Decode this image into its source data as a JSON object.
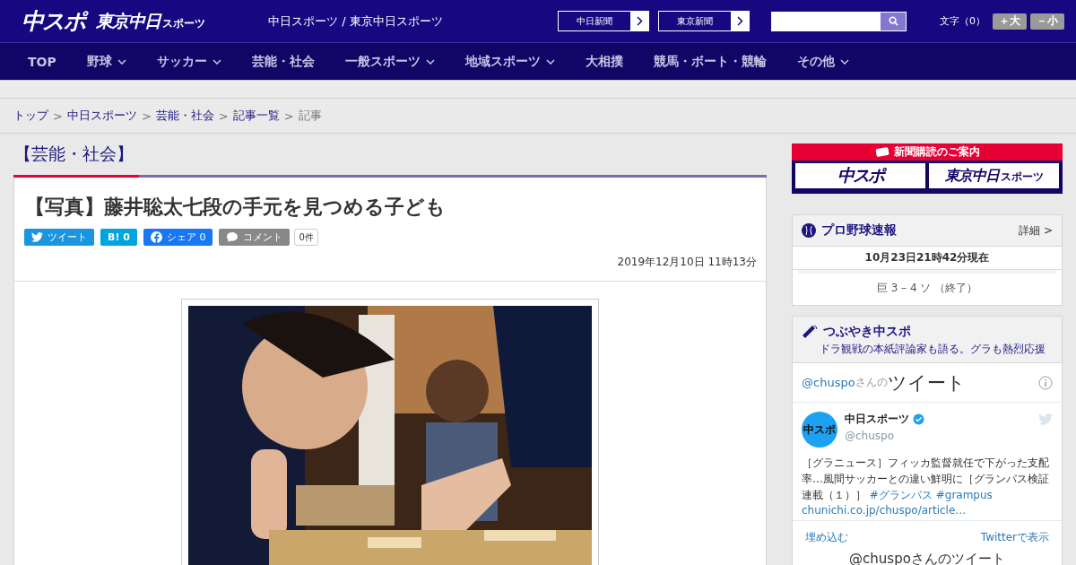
{
  "header": {
    "logo": {
      "main": "中スポ",
      "sub": "東京中日",
      "sub_small": "スポーツ"
    },
    "site_title": "中日スポーツ / 東京中日スポーツ",
    "paper_links": [
      "中日新聞",
      "東京新聞"
    ],
    "font_size": {
      "label": "文字（0）",
      "buttons": [
        "＋大",
        "－小"
      ]
    }
  },
  "nav": [
    {
      "label": "TOP",
      "has_menu": false
    },
    {
      "label": "野球",
      "has_menu": true
    },
    {
      "label": "サッカー",
      "has_menu": true
    },
    {
      "label": "芸能・社会",
      "has_menu": false
    },
    {
      "label": "一般スポーツ",
      "has_menu": true
    },
    {
      "label": "地域スポーツ",
      "has_menu": true
    },
    {
      "label": "大相撲",
      "has_menu": false
    },
    {
      "label": "競馬・ボート・競輪",
      "has_menu": false
    },
    {
      "label": "その他",
      "has_menu": true
    }
  ],
  "breadcrumb": [
    {
      "label": "トップ",
      "link": true
    },
    {
      "sep": ">",
      "label": "中日スポーツ",
      "link": true
    },
    {
      "sep": ">",
      "label": "芸能・社会",
      "link": true
    },
    {
      "sep": ">",
      "label": "記事一覧",
      "link": true
    },
    {
      "sep": ">",
      "label": "記事",
      "link": false
    }
  ],
  "category": "【芸能・社会】",
  "article": {
    "title": "【写真】藤井聡太七段の手元を見つめる子ども",
    "share": [
      {
        "kind": "twitter",
        "label": "ツイート"
      },
      {
        "kind": "hatena",
        "label": "B!",
        "count": "0"
      },
      {
        "kind": "facebook",
        "label": "シェア",
        "count": "0"
      },
      {
        "kind": "comment",
        "label": "コメント",
        "count": "0件"
      }
    ],
    "date": "2019年12月10日 11時13分"
  },
  "sidebar": {
    "subscribe": {
      "title": "新聞購読のご案内",
      "logos": [
        {
          "main": "中スポ"
        },
        {
          "main": "東京中日",
          "small": "スポーツ"
        }
      ]
    },
    "baseball": {
      "title": "プロ野球速報",
      "more": "詳細 >",
      "updated": "10月23日21時42分現在",
      "games": [
        "巨 3 – 4 ソ （終了）"
      ]
    },
    "tweets": {
      "title": "つぶやき中スポ",
      "subtitle": "ドラ観戦の本紙評論家も語る。グラも熱烈応援",
      "handle": "@chuspo",
      "handle_suffix": "さんの",
      "heading": "ツイート",
      "tweet": {
        "avatar_logo": "中スポ",
        "name": "中日スポーツ",
        "verified": true,
        "user": "@chuspo",
        "text": "［グラニュース］フィッカ監督就任で下がった支配率…風間サッカーとの違い鮮明に［グランパス検証連載（１）］",
        "tags": [
          "#グランパス",
          "#grampus"
        ],
        "link": "chunichi.co.jp/chuspo/article…"
      },
      "embed": "埋め込む",
      "view": "Twitterで表示",
      "footer": "@chuspoさんのツイート"
    }
  }
}
